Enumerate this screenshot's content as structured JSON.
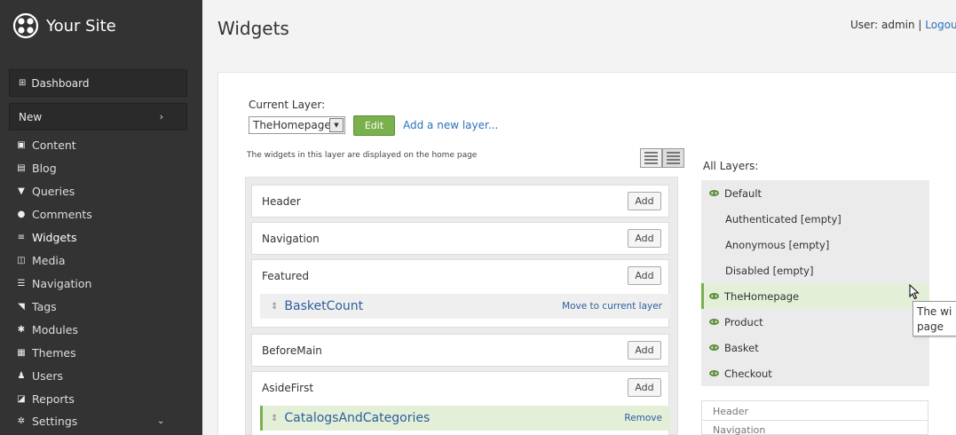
{
  "sidebar": {
    "brand": "Your Site",
    "dashboard": "Dashboard",
    "new": "New",
    "items": [
      {
        "label": "Content",
        "icon": "content-icon"
      },
      {
        "label": "Blog",
        "icon": "blog-icon"
      },
      {
        "label": "Queries",
        "icon": "filter-icon"
      },
      {
        "label": "Comments",
        "icon": "comment-icon"
      },
      {
        "label": "Widgets",
        "icon": "widgets-icon"
      },
      {
        "label": "Media",
        "icon": "media-icon"
      },
      {
        "label": "Navigation",
        "icon": "navigation-icon"
      },
      {
        "label": "Tags",
        "icon": "tag-icon"
      },
      {
        "label": "Modules",
        "icon": "modules-icon"
      },
      {
        "label": "Themes",
        "icon": "themes-icon"
      },
      {
        "label": "Users",
        "icon": "user-icon"
      },
      {
        "label": "Reports",
        "icon": "reports-icon"
      },
      {
        "label": "Settings",
        "icon": "gear-icon"
      }
    ]
  },
  "header": {
    "title": "Widgets",
    "user_prefix": "User: admin | ",
    "logout": "Logou"
  },
  "layer": {
    "label": "Current Layer:",
    "selected": "TheHomepage",
    "edit": "Edit",
    "add_new": "Add a new layer...",
    "description": "The widgets in this layer are displayed on the home page"
  },
  "zones": [
    {
      "name": "Header",
      "add": "Add"
    },
    {
      "name": "Navigation",
      "add": "Add"
    },
    {
      "name": "Featured",
      "add": "Add"
    },
    {
      "name": "BeforeMain",
      "add": "Add"
    },
    {
      "name": "AsideFirst",
      "add": "Add"
    }
  ],
  "widgets": [
    {
      "name": "BasketCount",
      "action": "Move to current layer"
    },
    {
      "name": "CatalogsAndCategories",
      "action": "Remove"
    }
  ],
  "all_layers": {
    "title": "All Layers:",
    "items": [
      "Default",
      "Authenticated [empty]",
      "Anonymous [empty]",
      "Disabled [empty]",
      "TheHomepage",
      "Product",
      "Basket",
      "Checkout"
    ]
  },
  "tooltip": {
    "line1": "The wi",
    "line2": "page"
  },
  "mini_zones": [
    "Header",
    "Navigation"
  ],
  "colors": {
    "sidebar": "#333333",
    "accent_green": "#7ab04e",
    "link": "#2b72b8"
  }
}
